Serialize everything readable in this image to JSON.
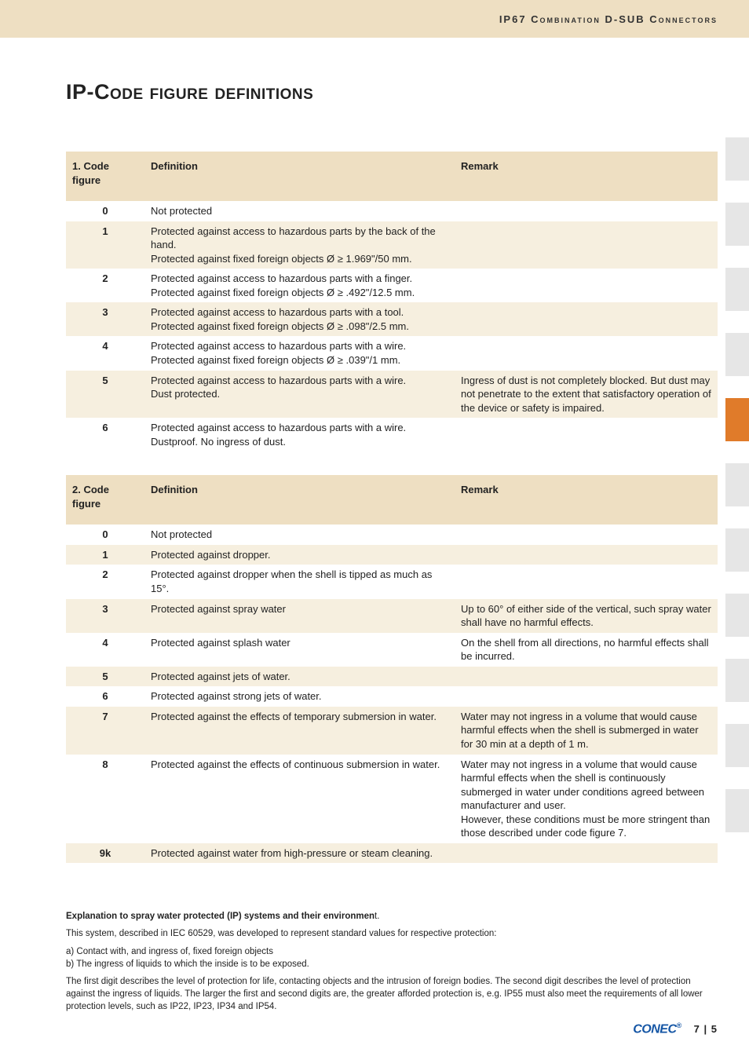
{
  "header": {
    "category": "IP67 Combination D-SUB Connectors"
  },
  "title": "IP-Code figure definitions",
  "table1": {
    "headers": {
      "code": "1. Code figure",
      "def": "Definition",
      "rem": "Remark"
    },
    "rows": [
      {
        "shade": false,
        "code": "0",
        "def": "Not protected",
        "rem": ""
      },
      {
        "shade": true,
        "code": "1",
        "def": "Protected against access to hazardous parts by the back of the hand.\nProtected against fixed foreign objects Ø ≥ 1.969\"/50 mm.",
        "rem": ""
      },
      {
        "shade": false,
        "code": "2",
        "def": "Protected against access to hazardous parts with a finger.\nProtected against fixed foreign objects Ø ≥ .492\"/12.5 mm.",
        "rem": ""
      },
      {
        "shade": true,
        "code": "3",
        "def": "Protected against access to hazardous parts with a tool.\nProtected against fixed foreign objects Ø ≥ .098\"/2.5 mm.",
        "rem": ""
      },
      {
        "shade": false,
        "code": "4",
        "def": "Protected against access to hazardous parts with a wire.\nProtected against fixed foreign objects Ø ≥ .039\"/1 mm.",
        "rem": ""
      },
      {
        "shade": true,
        "code": "5",
        "def": "Protected against access to hazardous parts with a wire.\nDust protected.",
        "rem": "Ingress of dust is not completely blocked. But dust may not penetrate to the extent that satisfactory operation of the device or safety is impaired."
      },
      {
        "shade": false,
        "code": "6",
        "def": "Protected against access to hazardous parts with a wire.\nDustproof. No ingress of dust.",
        "rem": ""
      }
    ]
  },
  "table2": {
    "headers": {
      "code": "2. Code figure",
      "def": "Definition",
      "rem": "Remark"
    },
    "rows": [
      {
        "shade": false,
        "code": "0",
        "def": "Not protected",
        "rem": ""
      },
      {
        "shade": true,
        "code": "1",
        "def": "Protected against dropper.",
        "rem": ""
      },
      {
        "shade": false,
        "code": "2",
        "def": "Protected against dropper when the shell is tipped as much as 15°.",
        "rem": ""
      },
      {
        "shade": true,
        "code": "3",
        "def": "Protected against spray water",
        "rem": "Up to 60° of either side of the vertical, such spray water shall have no harmful effects."
      },
      {
        "shade": false,
        "code": "4",
        "def": "Protected against splash water",
        "rem": "On the shell from all directions, no harmful effects shall be incurred."
      },
      {
        "shade": true,
        "code": "5",
        "def": "Protected against jets of water.",
        "rem": ""
      },
      {
        "shade": false,
        "code": "6",
        "def": "Protected against strong jets of water.",
        "rem": ""
      },
      {
        "shade": true,
        "code": "7",
        "def": "Protected against the effects of temporary submersion in water.",
        "rem": "Water may not ingress in a volume that would cause harmful effects when the shell is submerged in water for 30 min at a depth of 1 m."
      },
      {
        "shade": false,
        "code": "8",
        "def": "Protected against the effects of continuous submersion in water.",
        "rem": "Water may not ingress in a volume that would cause harmful effects when the shell is continuously submerged in water under conditions agreed between manufacturer and user.\nHowever, these conditions must be more stringent than those described under code figure 7."
      },
      {
        "shade": true,
        "code": "9k",
        "def": "Protected against water from high-pressure or steam cleaning.",
        "rem": ""
      }
    ]
  },
  "explain": {
    "heading_bold": "Explanation to spray water protected (IP) systems and their environmen",
    "heading_tail": "t.",
    "p1": "This system, described in IEC 60529, was developed to represent standard values for respective protection:",
    "a": "a) Contact with, and ingress of, fixed foreign objects",
    "b": "b) The ingress of liquids to which the inside is to be exposed.",
    "p2": "The first digit describes the level of protection for life, contacting objects and the intrusion of foreign bodies. The second digit describes the level of protection against the ingress of liquids. The larger the first and second digits are, the greater afforded protection is, e.g. IP55 must also meet the requirements of all lower protection levels, such as IP22, IP23, IP34 and IP54."
  },
  "footer": {
    "logo": "CONEC",
    "page": "7 | 5"
  },
  "tabs": {
    "count": 11,
    "active_index": 4
  }
}
